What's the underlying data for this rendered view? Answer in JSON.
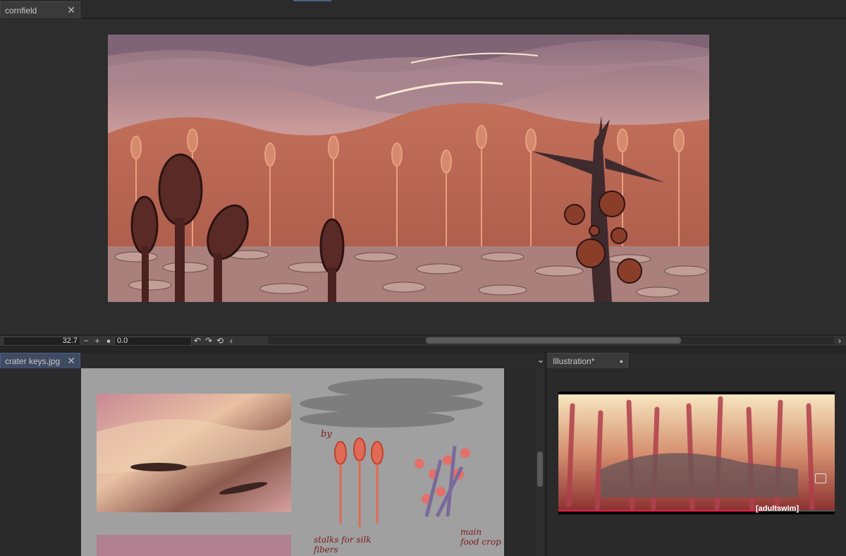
{
  "top_tab": {
    "label": "cornfield",
    "close": "✕"
  },
  "toolbar": {
    "zoom_value": "32.7",
    "zoom_out": "−",
    "zoom_in": "+",
    "fit": "■",
    "rotation_value": "0.0",
    "rotate_left": "↶",
    "rotate_right": "↷",
    "reset_rotation": "⟲",
    "scroll_left": "‹",
    "scroll_right": "›"
  },
  "bottom_left_tab": {
    "label": "crater keys.jpg",
    "close": "✕"
  },
  "bottom_right_tab": {
    "label": "Illustration*",
    "close": "●"
  },
  "panel_menu": "⌄",
  "sketch_notes": {
    "note1": "stalks for silk fibers",
    "note2": "main food crop",
    "by": "by"
  },
  "video_overlay": {
    "watermark": "[adultswim]"
  },
  "colors": {
    "accent_tab": "#4a5f86",
    "canvas_bg": "#2d2d2d",
    "video_progress": "#e0204a"
  },
  "icons": [
    "close-icon",
    "zoom-out-icon",
    "zoom-in-icon",
    "fit-icon",
    "rotate-left-icon",
    "rotate-right-icon",
    "reset-rotation-icon",
    "chevron-left-icon",
    "chevron-right-icon",
    "chevron-down-icon",
    "dot-icon",
    "pip-icon"
  ]
}
